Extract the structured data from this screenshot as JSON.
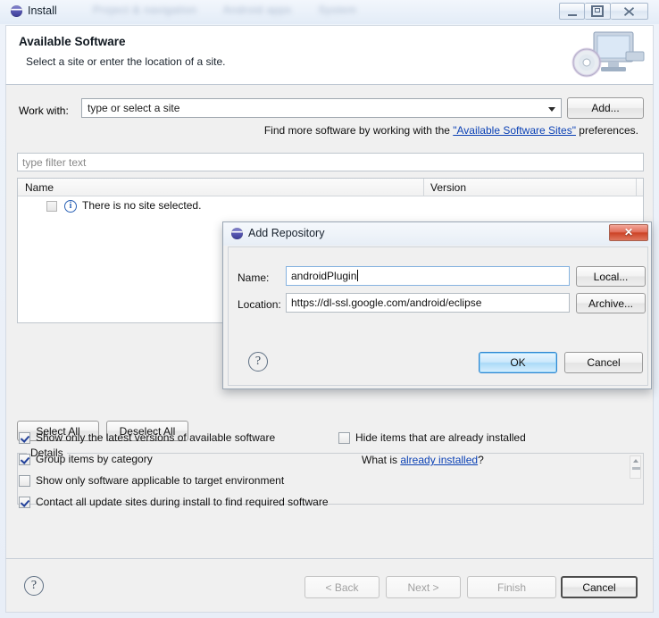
{
  "window": {
    "title": "Install",
    "title_icon": "eclipse-sphere-icon",
    "blurred_background_text": [
      "Project & navigation",
      "Android apps",
      "System"
    ],
    "controls": {
      "minimize": "minimize-icon",
      "maximize": "restore-icon",
      "close": "close-icon"
    }
  },
  "banner": {
    "title": "Available Software",
    "subtitle": "Select a site or enter the location of a site.",
    "art": "monitor-with-disc-icon"
  },
  "work_with": {
    "label": "Work with:",
    "value": "",
    "placeholder": "type or select a site",
    "dropdown_icon": "chevron-down-icon",
    "add_button": "Add..."
  },
  "find_more": {
    "prefix": "Find more software by working with the ",
    "link": "\"Available Software Sites\"",
    "suffix": " preferences."
  },
  "filter": {
    "value": "",
    "placeholder": "type filter text"
  },
  "table": {
    "columns": [
      "Name",
      "Version"
    ],
    "rows": [
      {
        "checked": false,
        "icon": "info-icon",
        "name": "There is no site selected.",
        "version": ""
      }
    ]
  },
  "selection_buttons": {
    "select_all": "Select All",
    "deselect_all": "Deselect All"
  },
  "details": {
    "legend": "Details",
    "content": ""
  },
  "options": {
    "left": [
      {
        "label": "Show only the latest versions of available software",
        "checked": true
      },
      {
        "label": "Group items by category",
        "checked": true
      },
      {
        "label": "Show only software applicable to target environment",
        "checked": false
      },
      {
        "label": "Contact all update sites during install to find required software",
        "checked": true
      }
    ],
    "right": [
      {
        "label": "Hide items that are already installed",
        "checked": false
      }
    ],
    "what_is": {
      "prefix": "What is ",
      "link": "already installed",
      "suffix": "?"
    }
  },
  "footer": {
    "help_icon": "help-question-icon",
    "buttons": [
      {
        "label": "< Back",
        "enabled": false
      },
      {
        "label": "Next >",
        "enabled": false
      },
      {
        "label": "Finish",
        "enabled": false
      },
      {
        "label": "Cancel",
        "enabled": true
      }
    ]
  },
  "dialog": {
    "title": "Add Repository",
    "title_icon": "eclipse-sphere-icon",
    "close_icon": "close-icon",
    "name": {
      "label": "Name:",
      "value": "androidPlugin",
      "focused": true
    },
    "location": {
      "label": "Location:",
      "value": "https://dl-ssl.google.com/android/eclipse"
    },
    "local_button": "Local...",
    "archive_button": "Archive...",
    "help_icon": "help-question-icon",
    "ok_button": "OK",
    "cancel_button": "Cancel"
  },
  "colors": {
    "link": "#0b41b5",
    "accent_blue": "#2f85d0",
    "close_red": "#cc4326"
  }
}
